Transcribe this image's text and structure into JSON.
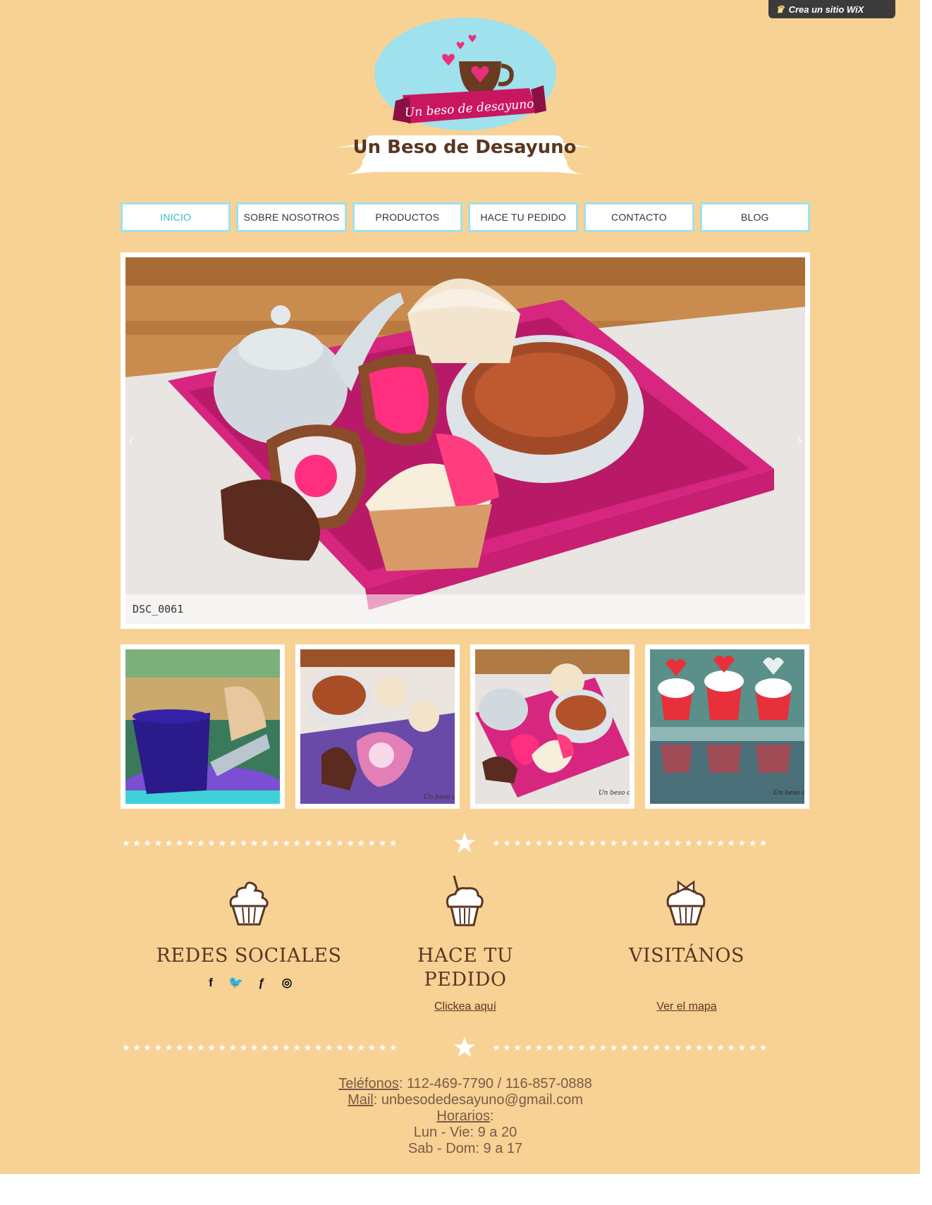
{
  "wix_banner": {
    "label": "Crea un sitio WiX"
  },
  "logo": {
    "ribbon_text": "Un beso de desayuno",
    "title": "Un Beso de Desayuno"
  },
  "nav": [
    {
      "label": "INICIO",
      "active": true
    },
    {
      "label": "SOBRE NOSOTROS"
    },
    {
      "label": "PRODUCTOS"
    },
    {
      "label": "HACE TU PEDIDO"
    },
    {
      "label": "CONTACTO"
    },
    {
      "label": "BLOG"
    }
  ],
  "slideshow": {
    "caption": "DSC_0061",
    "prev": "‹",
    "next": "›"
  },
  "thumb_watermark": "Un beso de d",
  "columns": {
    "social": {
      "title": "REDES SOCIALES",
      "icons": [
        "facebook-icon",
        "twitter-icon",
        "foursquare-icon",
        "instagram-icon"
      ]
    },
    "order": {
      "title_line1": "HACE TU",
      "title_line2": "PEDIDO",
      "link": "Clickea aquí"
    },
    "visit": {
      "title": "VISITÁNOS",
      "link": "Ver el mapa"
    }
  },
  "footer": {
    "phones_label": "Teléfonos",
    "phones_value": ": 112-469-7790 / 116-857-0888",
    "mail_label": "Mail",
    "mail_value": ": unbesodedesayuno@gmail.com",
    "hours_label": "Horarios",
    "hours_colon": ":",
    "weekday": "Lun - Vie: 9 a 20",
    "weekend": "Sab - Dom: 9 a 17"
  },
  "colors": {
    "background": "#f8d295",
    "accent": "#9fe1ec",
    "brown": "#5a3621",
    "pink": "#e8307a"
  }
}
